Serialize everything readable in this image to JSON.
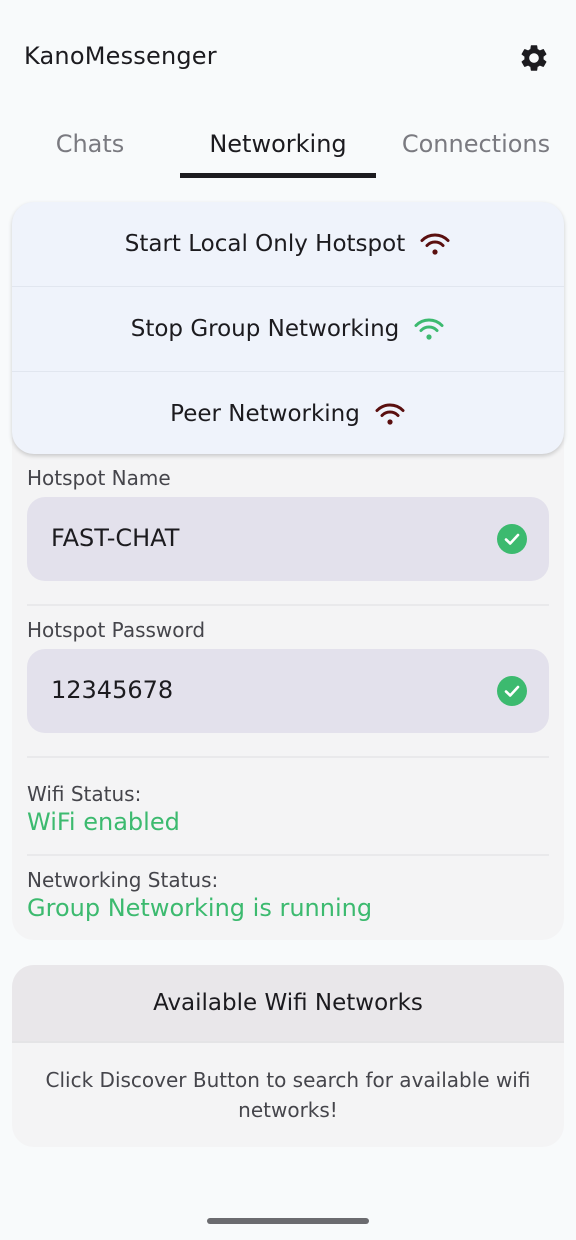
{
  "app": {
    "title": "KanoMessenger"
  },
  "icons": {
    "settings": "gear-icon",
    "wifi": "wifi-icon",
    "check": "check-circle-icon"
  },
  "tabs": [
    {
      "label": "Chats",
      "active": false
    },
    {
      "label": "Networking",
      "active": true
    },
    {
      "label": "Connections",
      "active": false
    }
  ],
  "actions": [
    {
      "label": "Start Local Only Hotspot",
      "icon_color": "#5a0f0f"
    },
    {
      "label": "Stop Group Networking",
      "icon_color": "#3cba6f"
    },
    {
      "label": "Peer Networking",
      "icon_color": "#5a0f0f"
    }
  ],
  "hotspot": {
    "name_label": "Hotspot Name",
    "name_value": "FAST-CHAT",
    "password_label": "Hotspot Password",
    "password_value": "12345678"
  },
  "status": {
    "wifi_label": "Wifi Status:",
    "wifi_value": "WiFi enabled",
    "networking_label": "Networking Status:",
    "networking_value": "Group Networking is running"
  },
  "networks": {
    "title": "Available Wifi Networks",
    "message": "Click Discover Button to search for available wifi networks!"
  },
  "colors": {
    "accent_green": "#3cba6f",
    "dark_red": "#5a0f0f",
    "field_bg": "#e3e1ec",
    "action_bg": "#eff3fb"
  }
}
